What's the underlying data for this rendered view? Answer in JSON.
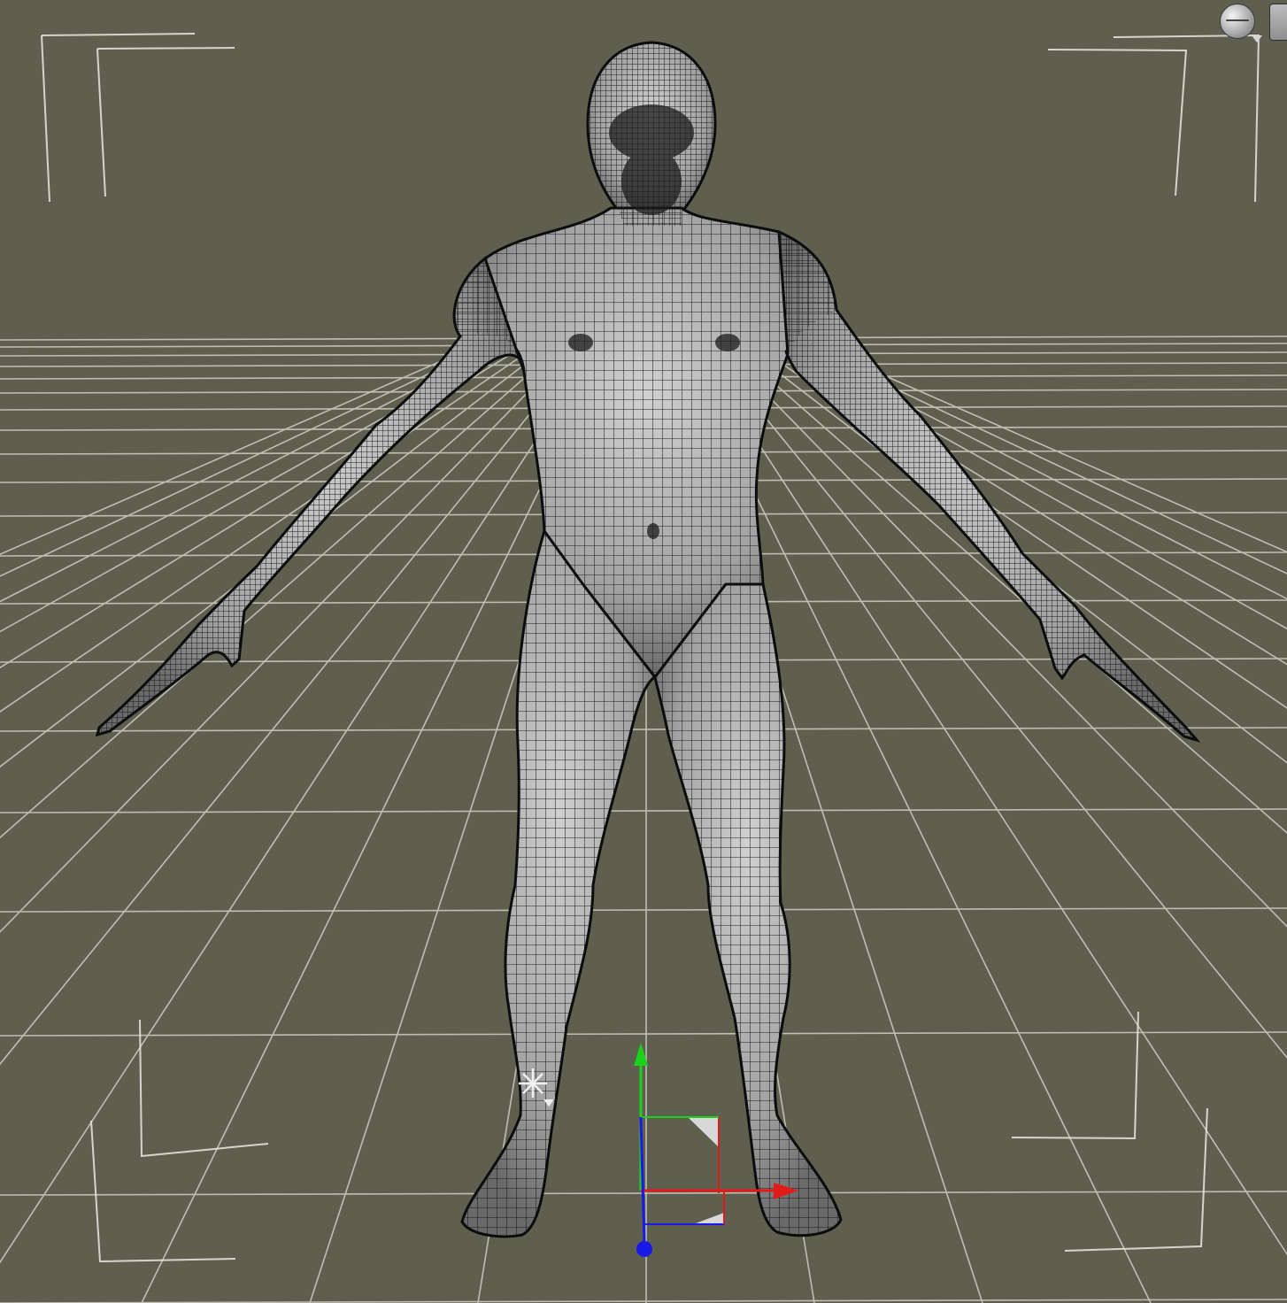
{
  "viewport": {
    "background_color": "#5f5f4f",
    "grid_color": "#c9c9bd",
    "frame_guide_color": "#e2e2da",
    "mesh_fill_color": "#a7a7a7",
    "mesh_wire_color": "#161616"
  },
  "gizmo": {
    "x_axis_color": "#e31a1a",
    "y_axis_color": "#1bd21b",
    "z_axis_color": "#1a1ae8"
  },
  "icons": {
    "view_sphere": "view-sphere-icon",
    "view_menu": "chevron-down-icon",
    "light": "light-sparkle-icon",
    "panel": "panel-button-icon"
  }
}
